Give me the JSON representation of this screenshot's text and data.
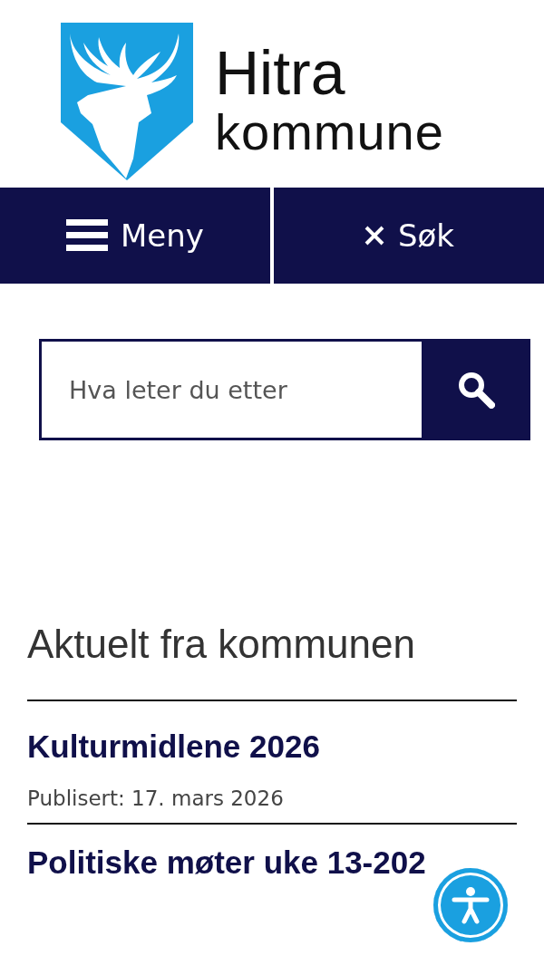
{
  "logo": {
    "name_line_1": "Hitra",
    "name_line_2": "kommune"
  },
  "nav": [
    {
      "kind": "menu",
      "label": "Meny"
    },
    {
      "kind": "close",
      "label": "Søk"
    }
  ],
  "search": {
    "placeholder": "Hva leter du etter"
  },
  "news": {
    "heading": "Aktuelt fra kommunen",
    "items": [
      {
        "title": "Kulturmidlene 2026",
        "published": "Publisert: 17. mars 2026"
      },
      {
        "title": "Politiske møter uke 13-202"
      }
    ]
  }
}
